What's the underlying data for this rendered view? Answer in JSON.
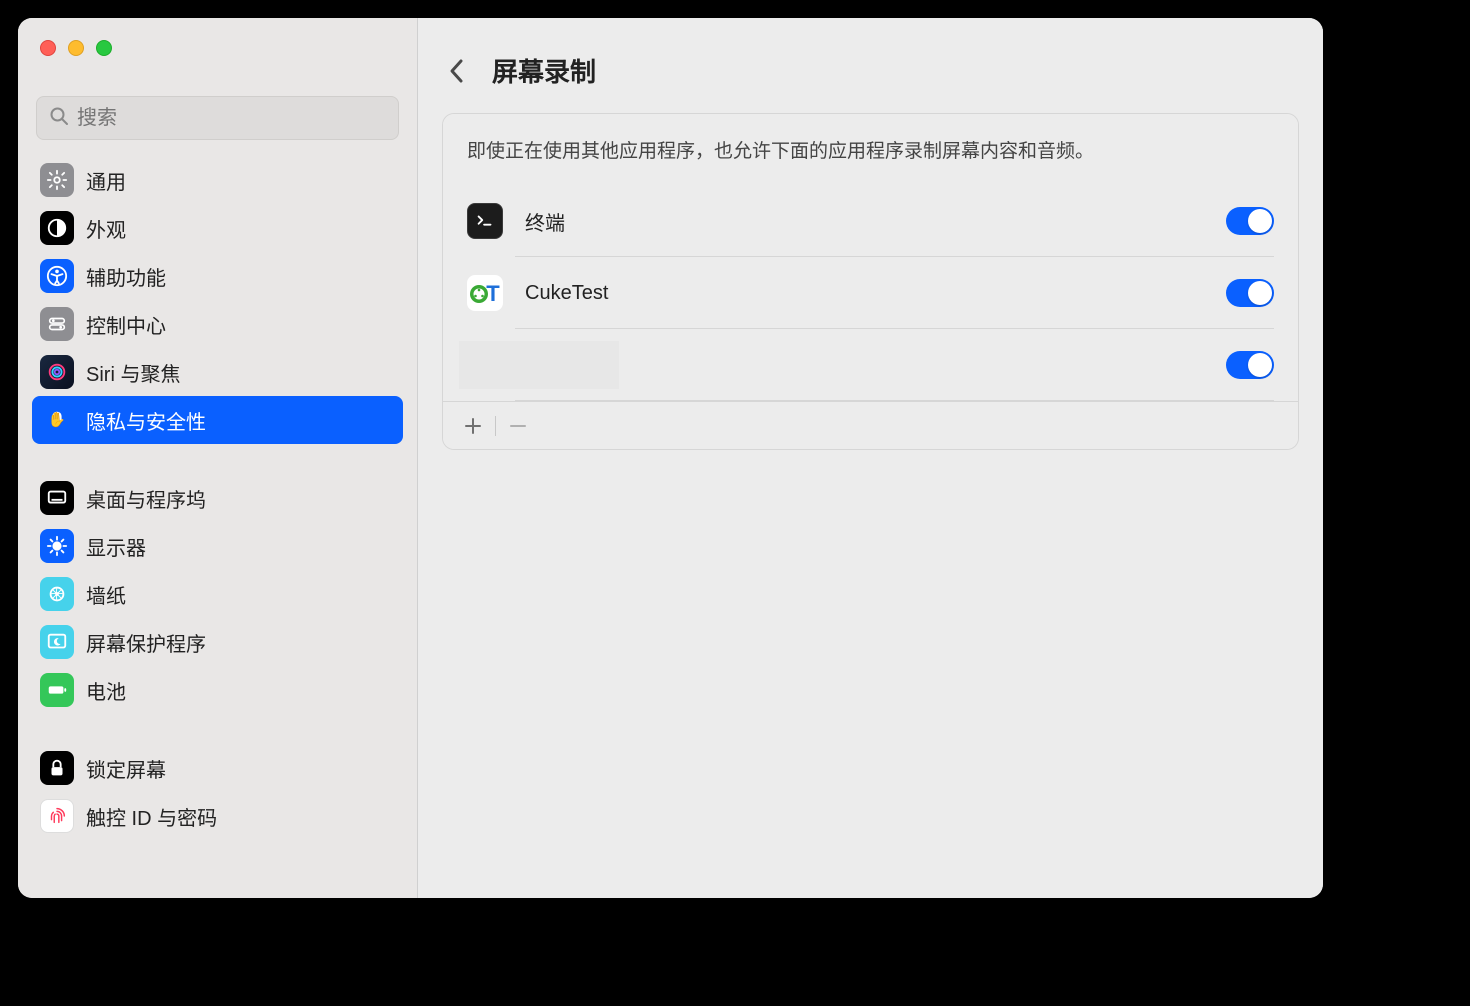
{
  "search": {
    "placeholder": "搜索"
  },
  "sidebar": {
    "groups": [
      [
        {
          "label": "通用",
          "icon": "gear",
          "bg": "#8e8e92"
        },
        {
          "label": "外观",
          "icon": "appearance",
          "bg": "#000000"
        },
        {
          "label": "辅助功能",
          "icon": "accessibility",
          "bg": "#0a60ff"
        },
        {
          "label": "控制中心",
          "icon": "control-center",
          "bg": "#8e8e92"
        },
        {
          "label": "Siri 与聚焦",
          "icon": "siri",
          "bg": "#1a1a1a"
        },
        {
          "label": "隐私与安全性",
          "icon": "privacy",
          "bg": "#0a60ff",
          "selected": true
        }
      ],
      [
        {
          "label": "桌面与程序坞",
          "icon": "dock",
          "bg": "#000000"
        },
        {
          "label": "显示器",
          "icon": "displays",
          "bg": "#0a60ff"
        },
        {
          "label": "墙纸",
          "icon": "wallpaper",
          "bg": "#46d2eb"
        },
        {
          "label": "屏幕保护程序",
          "icon": "screensaver",
          "bg": "#46d2eb"
        },
        {
          "label": "电池",
          "icon": "battery",
          "bg": "#34c759"
        }
      ],
      [
        {
          "label": "锁定屏幕",
          "icon": "lock",
          "bg": "#000000"
        },
        {
          "label": "触控 ID 与密码",
          "icon": "touchid",
          "bg": "#ffffff"
        }
      ]
    ]
  },
  "header": {
    "title": "屏幕录制"
  },
  "panel": {
    "description": "即使正在使用其他应用程序，也允许下面的应用程序录制屏幕内容和音频。",
    "apps": [
      {
        "name": "终端",
        "icon": "terminal",
        "enabled": true
      },
      {
        "name": "CukeTest",
        "icon": "cuketest",
        "enabled": true
      },
      {
        "name": "",
        "icon": "redacted",
        "enabled": true,
        "redacted": true
      }
    ]
  }
}
